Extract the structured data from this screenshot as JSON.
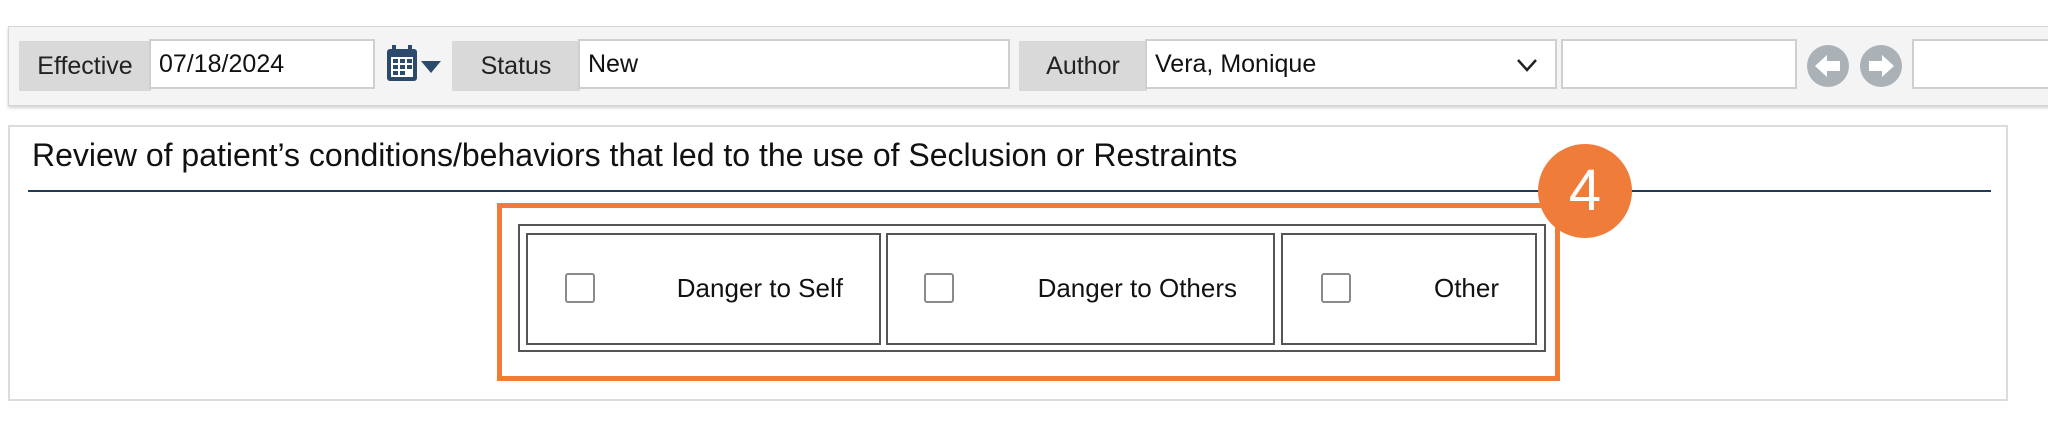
{
  "toolbar": {
    "effective_label": "Effective",
    "effective_value": "07/18/2024",
    "status_label": "Status",
    "status_value": "New",
    "author_label": "Author",
    "author_value": "Vera, Monique",
    "extra_field_value": "",
    "last_field_value": ""
  },
  "section": {
    "title": "Review of patient’s conditions/behaviors that led to the use of Seclusion or Restraints",
    "options": [
      {
        "label": "Danger to Self",
        "checked": false
      },
      {
        "label": "Danger to Others",
        "checked": false
      },
      {
        "label": "Other",
        "checked": false
      }
    ]
  },
  "callout": {
    "step": "4",
    "color": "#f07c3a"
  },
  "colors": {
    "accent_rule": "#1e3b57",
    "icon_blue": "#2c4a6b",
    "nav_gray": "#aab2b8"
  }
}
